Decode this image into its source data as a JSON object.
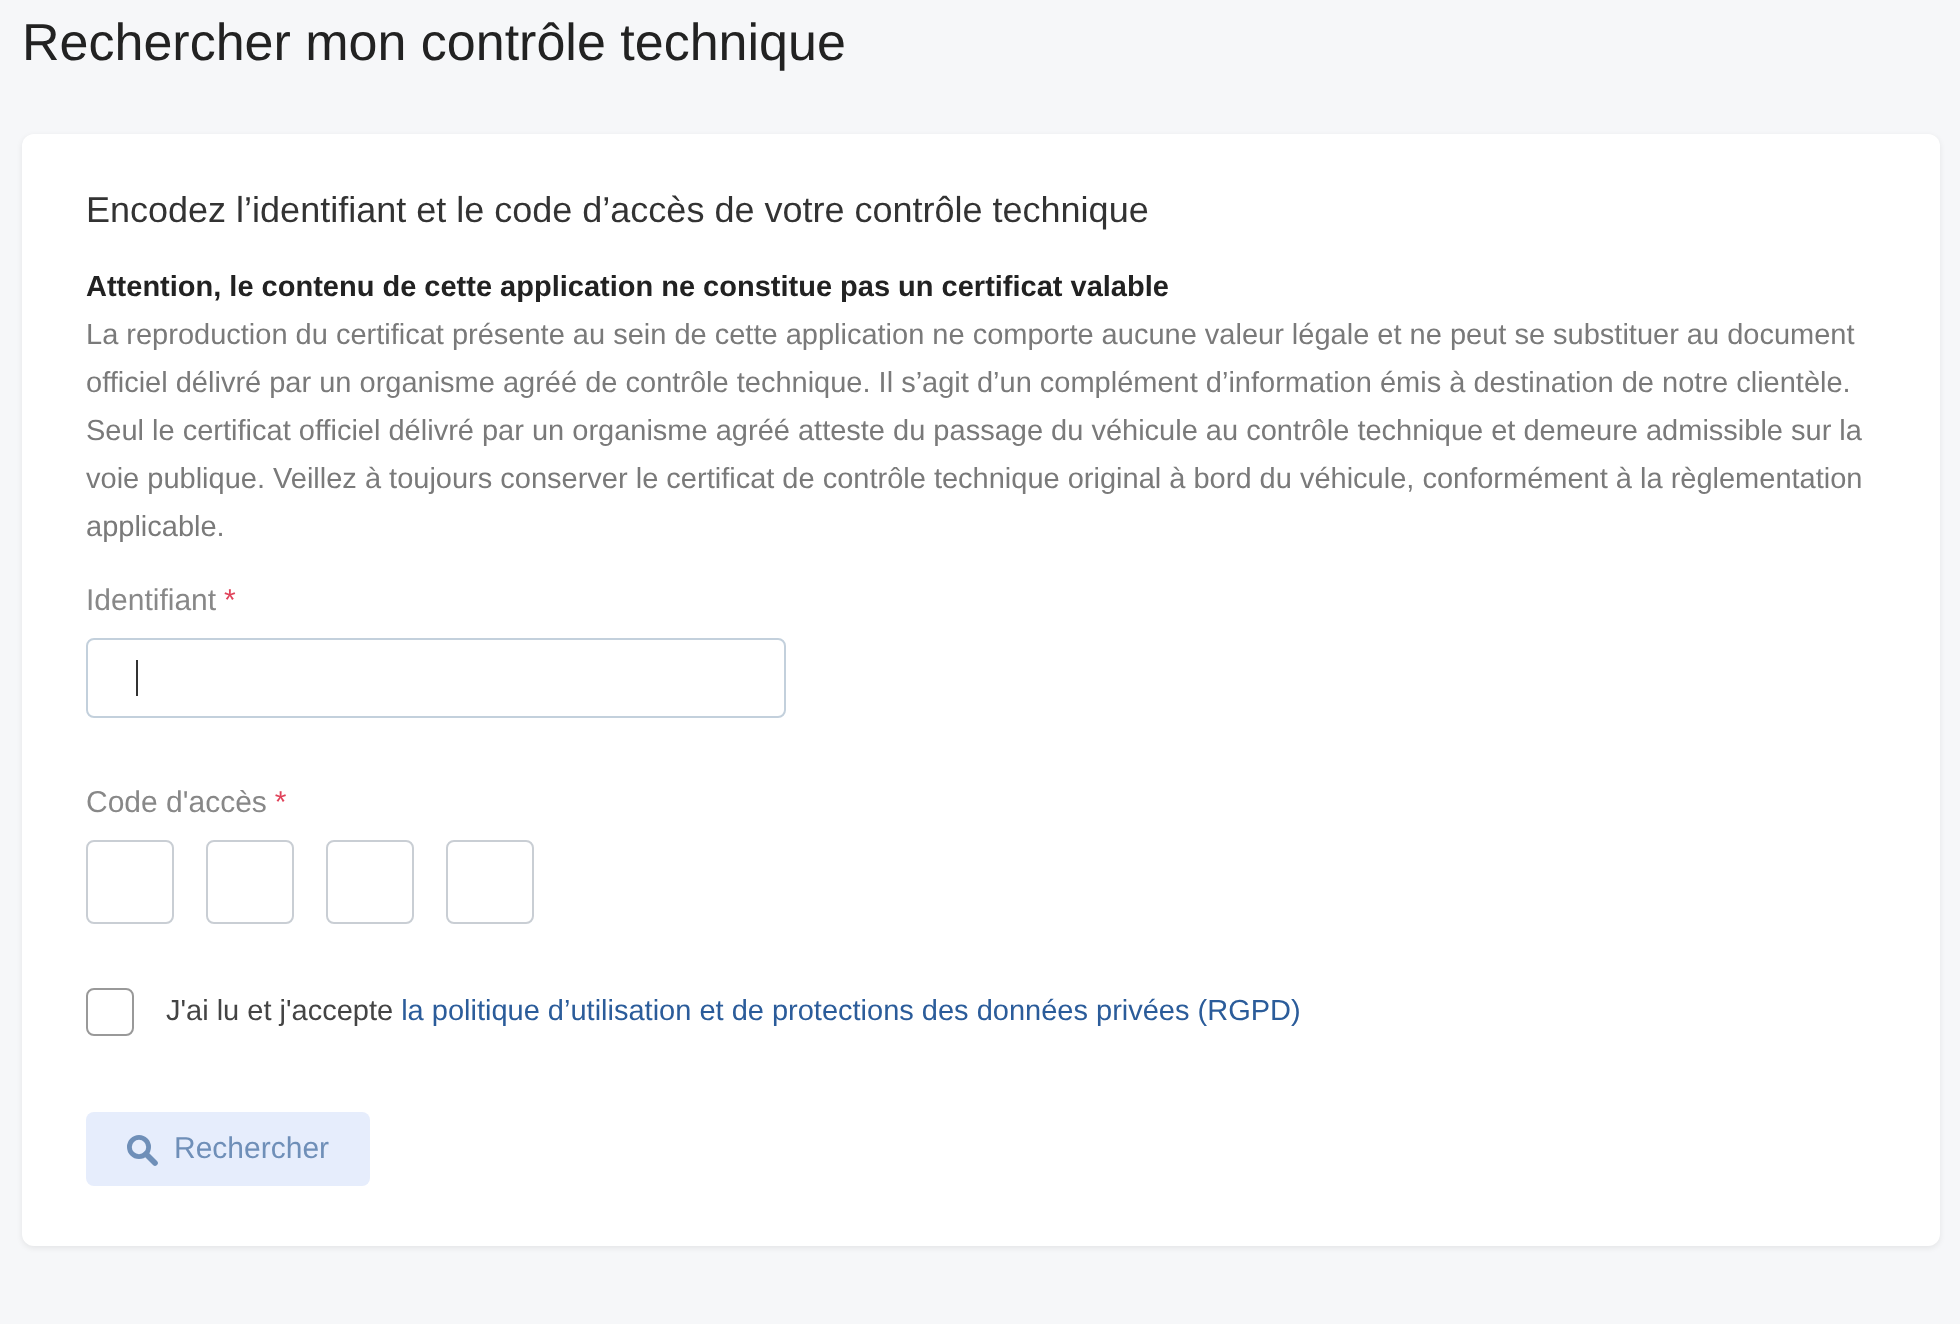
{
  "page_title": "Rechercher mon contrôle technique",
  "card": {
    "heading": "Encodez l’identifiant et le code d’accès de votre contrôle technique",
    "warning_title": "Attention, le contenu de cette application ne constitue pas un certificat valable",
    "warning_text": "La reproduction du certificat présente au sein de cette application ne comporte aucune valeur légale et ne peut se substituer au document officiel délivré par un organisme agréé de contrôle technique. Il s’agit d’un complément d’information émis à destination de notre clientèle. Seul le certificat officiel délivré par un organisme agréé atteste du passage du véhicule au contrôle technique et demeure admissible sur la voie publique. Veillez à toujours conserver le certificat de contrôle technique original à bord du véhicule, conformément à la règlementation applicable.",
    "identifier": {
      "label": "Identifiant",
      "required_mark": "*",
      "focused": true
    },
    "access_code": {
      "label": "Code d'accès",
      "required_mark": "*",
      "cells": [
        {
          "filled": false
        },
        {
          "filled": false
        },
        {
          "filled": false
        },
        {
          "filled": false
        }
      ]
    },
    "consent": {
      "text": "J'ai lu et j'accepte",
      "link": "la politique d’utilisation et de protections des données privées (RGPD)",
      "checked": false
    },
    "search_button": {
      "label": "Rechercher",
      "disabled": true
    }
  }
}
